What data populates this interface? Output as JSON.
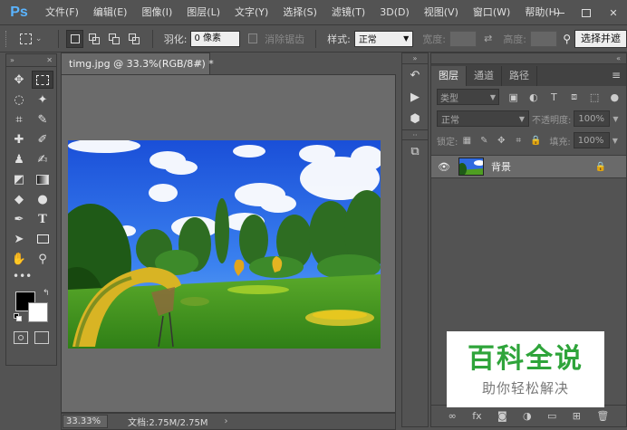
{
  "app": {
    "logo": "Ps",
    "menu": [
      "文件(F)",
      "编辑(E)",
      "图像(I)",
      "图层(L)",
      "文字(Y)",
      "选择(S)",
      "滤镜(T)",
      "3D(D)",
      "视图(V)",
      "窗口(W)",
      "帮助(H)"
    ]
  },
  "options": {
    "feather_label": "羽化:",
    "feather_value": "0 像素",
    "antialias_label": "消除锯齿",
    "style_label": "样式:",
    "style_value": "正常",
    "width_label": "宽度:",
    "height_label": "高度:",
    "select_mask_button": "选择并遮"
  },
  "document": {
    "tab_title": "timg.jpg @ 33.3%(RGB/8#) *",
    "close": "×",
    "zoom": "33.33%",
    "doc_size": "文档:2.75M/2.75M",
    "status_arrow": "›"
  },
  "layers": {
    "tabs": [
      "图层",
      "通道",
      "路径"
    ],
    "kind_filter": "类型",
    "blend_mode": "正常",
    "opacity_label": "不透明度:",
    "opacity_value": "100%",
    "lock_label": "锁定:",
    "fill_label": "填充:",
    "fill_value": "100%",
    "layer_name": "背景",
    "footer_fx": "fx"
  },
  "watermark": {
    "title": "百科全说",
    "subtitle": "助你轻松解决"
  },
  "colors": {
    "foreground": "#000000",
    "background": "#ffffff"
  }
}
